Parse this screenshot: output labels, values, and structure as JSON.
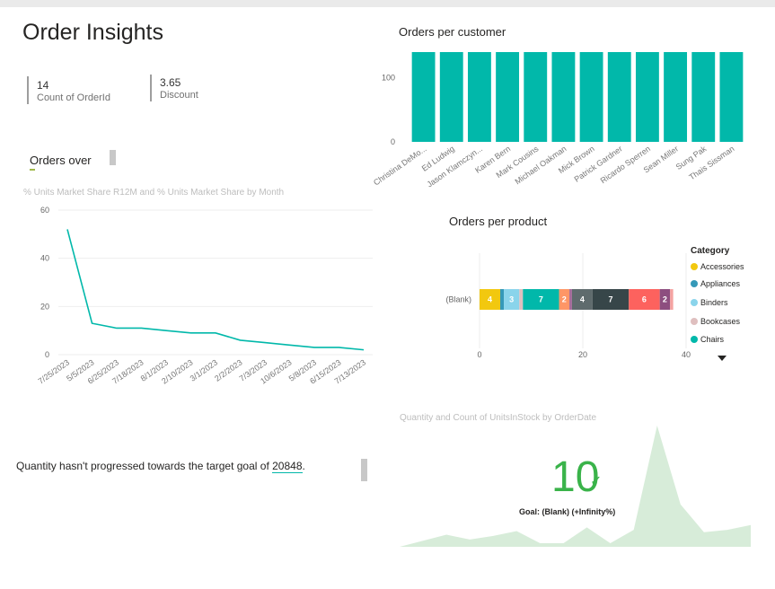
{
  "page": {
    "title": "Order Insights"
  },
  "kpis": [
    {
      "value": "14",
      "label": "Count of OrderId"
    },
    {
      "value": "3.65",
      "label": "Discount"
    }
  ],
  "orders_over": {
    "title": "Orders over"
  },
  "line_chart": {
    "subtitle": "% Units Market Share R12M and % Units Market Share by Month"
  },
  "customers_chart": {
    "title": "Orders per customer"
  },
  "product_chart": {
    "title": "Orders per product",
    "legend_title": "Category",
    "legend": [
      {
        "name": "Accessories",
        "color": "#f2c80f"
      },
      {
        "name": "Appliances",
        "color": "#3599b8"
      },
      {
        "name": "Binders",
        "color": "#8ad4eb"
      },
      {
        "name": "Bookcases",
        "color": "#dfbfbf"
      },
      {
        "name": "Chairs",
        "color": "#01b8aa"
      }
    ]
  },
  "insight": {
    "text": "Quantity hasn't progressed towards the target goal of ",
    "goal": "20848",
    "period": "."
  },
  "stock_chart": {
    "subtitle": "Quantity and Count of UnitsInStock by OrderDate",
    "kpi_value": "10",
    "check_icon": "check-icon",
    "goal_text": "Goal: (Blank) (+Infinity%)",
    "color": "#3ab34a"
  },
  "chart_data": [
    {
      "type": "line",
      "title": "",
      "x": [
        "7/25/2023",
        "5/5/2023",
        "6/25/2023",
        "7/18/2023",
        "8/1/2023",
        "2/10/2023",
        "3/1/2023",
        "2/2/2023",
        "7/3/2023",
        "10/6/2023",
        "5/8/2023",
        "6/15/2023",
        "7/13/2023"
      ],
      "series": [
        {
          "values": [
            52,
            13,
            11,
            11,
            10,
            9,
            9,
            6,
            5,
            4,
            3,
            3,
            2
          ],
          "color": "#01b8aa"
        }
      ],
      "ylim": [
        0,
        60
      ],
      "yticks": [
        0,
        20,
        40,
        60
      ],
      "grid": true
    },
    {
      "type": "bar",
      "title": "Orders per customer",
      "categories": [
        "Christina DeMo...",
        "Ed Ludwig",
        "Jason Klamczyn...",
        "Karen Bern",
        "Mark Cousins",
        "Michael Oakman",
        "Mick Brown",
        "Patrick Gardner",
        "Ricardo Sperren",
        "Sean Miller",
        "Sung Pak",
        "Thais Sissman"
      ],
      "values": [
        140,
        140,
        140,
        140,
        140,
        140,
        140,
        140,
        140,
        140,
        140,
        140
      ],
      "ylim": [
        0,
        140
      ],
      "yticks": [
        0,
        100
      ],
      "color": "#01b8aa"
    },
    {
      "type": "bar",
      "title": "Orders per product",
      "orientation": "horizontal",
      "stacked": true,
      "categories": [
        "(Blank)"
      ],
      "segments": [
        {
          "value": 4,
          "color": "#f2c80f",
          "label": "4"
        },
        {
          "value": 0.7,
          "color": "#3599b8",
          "label": ""
        },
        {
          "value": 3,
          "color": "#8ad4eb",
          "label": "3"
        },
        {
          "value": 0.7,
          "color": "#dfbfbf",
          "label": ""
        },
        {
          "value": 7,
          "color": "#01b8aa",
          "label": "7"
        },
        {
          "value": 2,
          "color": "#fe9666",
          "label": "2"
        },
        {
          "value": 0.5,
          "color": "#a66999",
          "label": ""
        },
        {
          "value": 4,
          "color": "#5f6b6d",
          "label": "4"
        },
        {
          "value": 7,
          "color": "#374649",
          "label": "7"
        },
        {
          "value": 6,
          "color": "#fd625e",
          "label": "6"
        },
        {
          "value": 2,
          "color": "#8d4e7f",
          "label": "2"
        },
        {
          "value": 0.6,
          "color": "#f5a3a1",
          "label": ""
        }
      ],
      "xlim": [
        0,
        40
      ],
      "xticks": [
        0,
        20,
        40
      ]
    },
    {
      "type": "area",
      "title": "Quantity and Count of UnitsInStock by OrderDate",
      "values": [
        0,
        5,
        10,
        6,
        9,
        13,
        3,
        3,
        16,
        3,
        14,
        100,
        35,
        12,
        14,
        18
      ],
      "color": "#d7ecd9"
    }
  ]
}
